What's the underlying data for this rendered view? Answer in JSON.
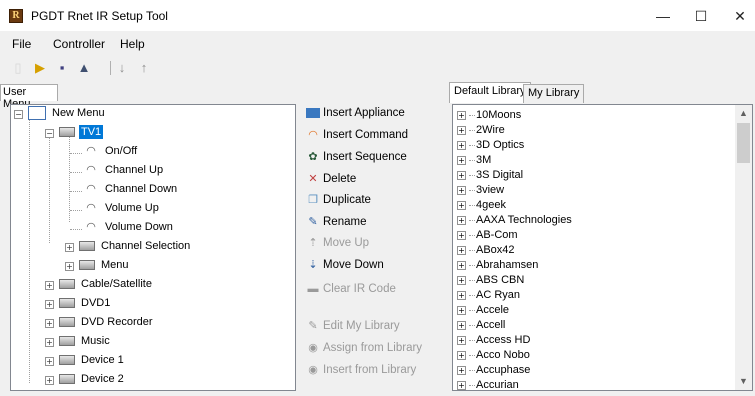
{
  "window": {
    "title": "PGDT Rnet IR Setup Tool",
    "minimize": "—",
    "maximize": "☐",
    "close": "✕"
  },
  "menu": [
    "File",
    "Controller",
    "Help"
  ],
  "left_tab": "User Menu",
  "tree": {
    "root": "New Menu",
    "tv1": "TV1",
    "tv1_commands": [
      "On/Off",
      "Channel Up",
      "Channel Down",
      "Volume Up",
      "Volume Down"
    ],
    "tv1_submenus": [
      "Channel Selection",
      "Menu"
    ],
    "appliances": [
      "Cable/Satellite",
      "DVD1",
      "DVD Recorder",
      "Music",
      "Device 1",
      "Device 2"
    ]
  },
  "actions": [
    {
      "label": "Insert Appliance",
      "enabled": true,
      "icon": "appliance-icon"
    },
    {
      "label": "Insert Command",
      "enabled": true,
      "icon": "command-icon"
    },
    {
      "label": "Insert Sequence",
      "enabled": true,
      "icon": "sequence-icon"
    },
    {
      "label": "Delete",
      "enabled": true,
      "icon": "delete-icon"
    },
    {
      "label": "Duplicate",
      "enabled": true,
      "icon": "duplicate-icon"
    },
    {
      "label": "Rename",
      "enabled": true,
      "icon": "rename-icon"
    },
    {
      "label": "Move Up",
      "enabled": false,
      "icon": "move-up-icon"
    },
    {
      "label": "Move Down",
      "enabled": true,
      "icon": "move-down-icon"
    },
    {
      "label": "Clear IR Code",
      "enabled": false,
      "icon": "clear-icon"
    },
    {
      "label": "Edit My Library",
      "enabled": false,
      "icon": "edit-icon"
    },
    {
      "label": "Assign from Library",
      "enabled": false,
      "icon": "assign-icon"
    },
    {
      "label": "Insert from Library",
      "enabled": false,
      "icon": "insert-library-icon"
    }
  ],
  "right_tabs": [
    "Default Library",
    "My Library"
  ],
  "library": [
    "10Moons",
    "2Wire",
    "3D Optics",
    "3M",
    "3S Digital",
    "3view",
    "4geek",
    "AAXA Technologies",
    "AB-Com",
    "ABox42",
    "Abrahamsen",
    "ABS CBN",
    "AC Ryan",
    "Accele",
    "Accell",
    "Access HD",
    "Acco Nobo",
    "Accuphase",
    "Accurian"
  ]
}
